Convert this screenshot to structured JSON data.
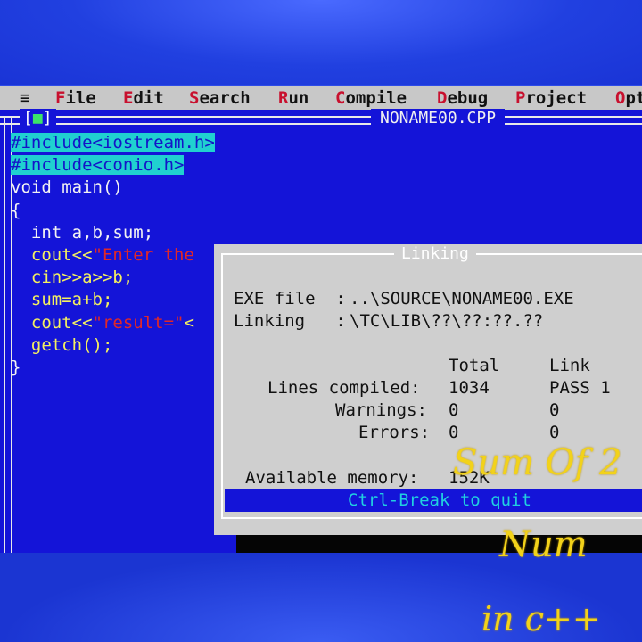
{
  "menu": {
    "system": "≡",
    "items": [
      {
        "hot": "F",
        "rest": "ile"
      },
      {
        "hot": "E",
        "rest": "dit"
      },
      {
        "hot": "S",
        "rest": "earch"
      },
      {
        "hot": "R",
        "rest": "un"
      },
      {
        "hot": "C",
        "rest": "ompile"
      },
      {
        "hot": "D",
        "rest": "ebug"
      },
      {
        "hot": "P",
        "rest": "roject"
      },
      {
        "hot": "O",
        "rest": "pt"
      }
    ]
  },
  "window": {
    "close_box": "[",
    "close_mark": "■",
    "close_end": "]",
    "filename": "NONAME00.CPP"
  },
  "code": {
    "line1": "#include<iostream.h>",
    "line2": "#include<conio.h>",
    "line3": "void main()",
    "line4": "{",
    "line5": "  int a,b,sum;",
    "line6a": "  cout<<",
    "line6b": "\"Enter the",
    "line7": "  cin>>a>>b;",
    "line8": "  sum=a+b;",
    "line9a": "  cout<<",
    "line9b": "\"result=\"",
    "line9c": "<",
    "line10": "  getch();",
    "line11": "}"
  },
  "linking_dialog": {
    "title": "Linking",
    "exe_label": "EXE file  :",
    "exe_value": "..\\SOURCE\\NONAME00.EXE",
    "linking_label": "Linking   :",
    "linking_value": "\\TC\\LIB\\??\\??:??.??",
    "col_total": "Total",
    "col_link": "Link",
    "rows": [
      {
        "label": "Lines compiled:",
        "total": "1034",
        "link": "PASS 1"
      },
      {
        "label": "Warnings:",
        "total": "0",
        "link": "0"
      },
      {
        "label": "Errors:",
        "total": "0",
        "link": "0"
      }
    ],
    "memory_label": "Available memory:",
    "memory_value": "152K",
    "quit": "Ctrl-Break to quit"
  },
  "overlay": {
    "line1": "Sum Of 2",
    "line2": "Num",
    "line3": "in c++"
  }
}
